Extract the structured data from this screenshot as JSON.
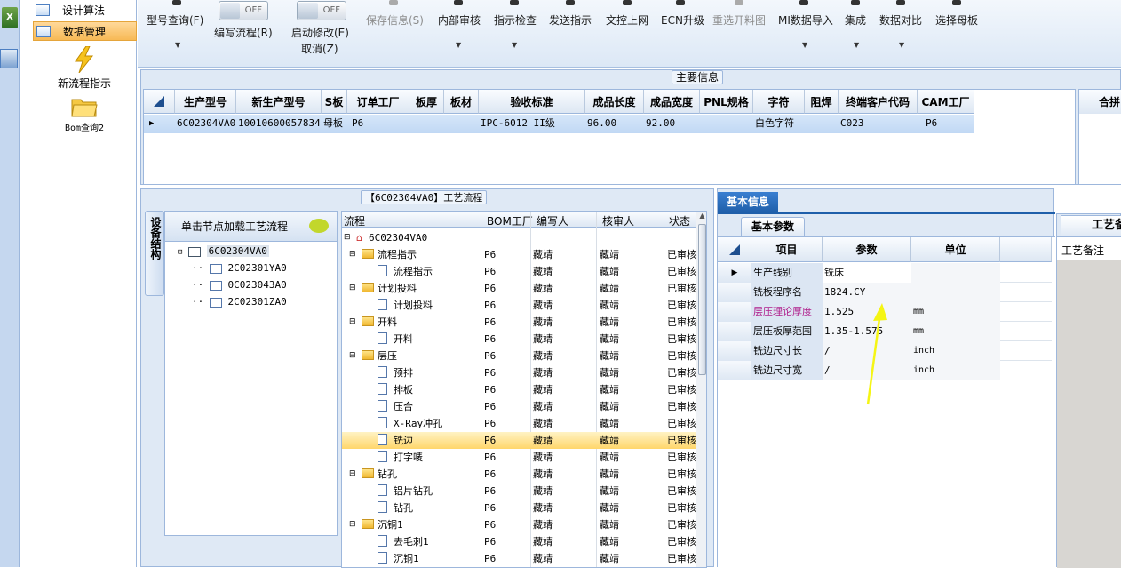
{
  "nav": {
    "items": [
      {
        "label": "设计算法",
        "active": false
      },
      {
        "label": "数据管理",
        "active": true
      }
    ],
    "big": [
      {
        "label": "新流程指示",
        "icon": "lightning-icon"
      },
      {
        "label": "Bom查询2",
        "icon": "folder-icon"
      }
    ]
  },
  "toolbar": {
    "query": "型号查询(F)",
    "edit_flow": "编写流程(R)",
    "edit_flow_toggle": "OFF",
    "start_modify": "启动修改(E)",
    "start_modify_toggle": "OFF",
    "cancel": "取消(Z)",
    "save": "保存信息(S)",
    "audit": "内部审核",
    "check": "指示检查",
    "send": "发送指示",
    "upload": "文控上网",
    "ecn": "ECN升级",
    "reselect": "重选开料图",
    "mi_import": "MI数据导入",
    "integrate": "集成",
    "compare": "数据对比",
    "select_board": "选择母板"
  },
  "main": {
    "title": "主要信息",
    "columns": [
      "生产型号",
      "新生产型号",
      "S板",
      "订单工厂",
      "板厚",
      "板材",
      "验收标准",
      "成品长度",
      "成品宽度",
      "PNL规格",
      "字符",
      "阻焊",
      "终端客户代码",
      "CAM工厂"
    ],
    "row": [
      "6C02304VA0",
      "10010600057834",
      "母板",
      "P6",
      "",
      "",
      "IPC-6012 II级",
      "96.00",
      "92.00",
      "",
      "白色字符",
      "",
      "C023",
      "P6"
    ],
    "right_header": "合拼"
  },
  "flow": {
    "title": "【6C02304VA0】工艺流程",
    "side_tab": "设备结构",
    "tree_header": "单击节点加载工艺流程",
    "tree": [
      "6C02304VA0",
      "2C02301YA0",
      "0C023043A0",
      "2C02301ZA0"
    ],
    "columns": [
      "流程",
      "BOM工厂",
      "编写人",
      "核审人",
      "状态"
    ],
    "rows": [
      {
        "name": "6C02304VA0",
        "level": 0,
        "type": "root",
        "bom": "",
        "writer": "",
        "reviewer": "",
        "status": ""
      },
      {
        "name": "流程指示",
        "level": 1,
        "type": "folder",
        "bom": "P6",
        "writer": "藏靖",
        "reviewer": "藏靖",
        "status": "已审核"
      },
      {
        "name": "流程指示",
        "level": 2,
        "type": "doc",
        "bom": "P6",
        "writer": "藏靖",
        "reviewer": "藏靖",
        "status": "已审核"
      },
      {
        "name": "计划投料",
        "level": 1,
        "type": "folder",
        "bom": "P6",
        "writer": "藏靖",
        "reviewer": "藏靖",
        "status": "已审核"
      },
      {
        "name": "计划投料",
        "level": 2,
        "type": "doc",
        "bom": "P6",
        "writer": "藏靖",
        "reviewer": "藏靖",
        "status": "已审核"
      },
      {
        "name": "开料",
        "level": 1,
        "type": "folder",
        "bom": "P6",
        "writer": "藏靖",
        "reviewer": "藏靖",
        "status": "已审核"
      },
      {
        "name": "开料",
        "level": 2,
        "type": "doc",
        "bom": "P6",
        "writer": "藏靖",
        "reviewer": "藏靖",
        "status": "已审核"
      },
      {
        "name": "层压",
        "level": 1,
        "type": "folder",
        "bom": "P6",
        "writer": "藏靖",
        "reviewer": "藏靖",
        "status": "已审核"
      },
      {
        "name": "预排",
        "level": 2,
        "type": "doc",
        "bom": "P6",
        "writer": "藏靖",
        "reviewer": "藏靖",
        "status": "已审核"
      },
      {
        "name": "排板",
        "level": 2,
        "type": "doc",
        "bom": "P6",
        "writer": "藏靖",
        "reviewer": "藏靖",
        "status": "已审核"
      },
      {
        "name": "压合",
        "level": 2,
        "type": "doc",
        "bom": "P6",
        "writer": "藏靖",
        "reviewer": "藏靖",
        "status": "已审核"
      },
      {
        "name": "X-Ray冲孔",
        "level": 2,
        "type": "doc",
        "bom": "P6",
        "writer": "藏靖",
        "reviewer": "藏靖",
        "status": "已审核"
      },
      {
        "name": "铣边",
        "level": 2,
        "type": "doc",
        "bom": "P6",
        "writer": "藏靖",
        "reviewer": "藏靖",
        "status": "已审核",
        "selected": true
      },
      {
        "name": "打字唛",
        "level": 2,
        "type": "doc",
        "bom": "P6",
        "writer": "藏靖",
        "reviewer": "藏靖",
        "status": "已审核"
      },
      {
        "name": "钻孔",
        "level": 1,
        "type": "folder",
        "bom": "P6",
        "writer": "藏靖",
        "reviewer": "藏靖",
        "status": "已审核"
      },
      {
        "name": "铝片钻孔",
        "level": 2,
        "type": "doc",
        "bom": "P6",
        "writer": "藏靖",
        "reviewer": "藏靖",
        "status": "已审核"
      },
      {
        "name": "钻孔",
        "level": 2,
        "type": "doc",
        "bom": "P6",
        "writer": "藏靖",
        "reviewer": "藏靖",
        "status": "已审核"
      },
      {
        "name": "沉铜1",
        "level": 1,
        "type": "folder",
        "bom": "P6",
        "writer": "藏靖",
        "reviewer": "藏靖",
        "status": "已审核"
      },
      {
        "name": "去毛刺1",
        "level": 2,
        "type": "doc",
        "bom": "P6",
        "writer": "藏靖",
        "reviewer": "藏靖",
        "status": "已审核"
      },
      {
        "name": "沉铜1",
        "level": 2,
        "type": "doc",
        "bom": "P6",
        "writer": "藏靖",
        "reviewer": "藏靖",
        "status": "已审核"
      }
    ]
  },
  "base": {
    "tab": "基本信息",
    "subtab": "基本参数",
    "columns": [
      "项目",
      "参数",
      "单位"
    ],
    "rows": [
      {
        "item": "生产线别",
        "param": "铣床",
        "unit": "",
        "highlight": false
      },
      {
        "item": "铣板程序名",
        "param": "1824.CY",
        "unit": "",
        "highlight": false
      },
      {
        "item": "层压理论厚度",
        "param": "1.525",
        "unit": "mm",
        "highlight": true
      },
      {
        "item": "层压板厚范围",
        "param": "1.35-1.575",
        "unit": "mm",
        "highlight": false
      },
      {
        "item": "铣边尺寸长",
        "param": "/",
        "unit": "inch",
        "highlight": false
      },
      {
        "item": "铣边尺寸宽",
        "param": "/",
        "unit": "inch",
        "highlight": false
      }
    ]
  },
  "right": {
    "tab": "工艺备",
    "label": "工艺备注"
  },
  "colors": {
    "accent": "#1f6bc2",
    "selection": "#ffd66b",
    "highlight_text": "#b0208c",
    "annotation_arrow": "#f5f514"
  }
}
